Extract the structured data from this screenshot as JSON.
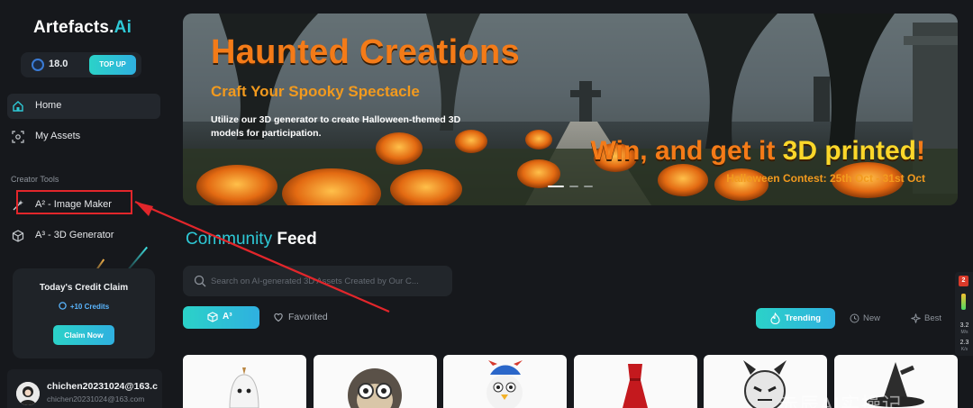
{
  "brand": {
    "name_main": "Artefacts.",
    "name_accent": "Ai"
  },
  "credits": {
    "balance": "18.0",
    "topup_label": "TOP UP"
  },
  "nav": {
    "home": "Home",
    "assets": "My Assets",
    "section": "Creator Tools",
    "image_maker": "A² - Image Maker",
    "generator_3d": "A³ - 3D Generator"
  },
  "claim": {
    "title": "Today's Credit Claim",
    "credits": "+10 Credits",
    "button": "Claim Now"
  },
  "user": {
    "name": "chichen20231024@163.c",
    "email": "chichen20231024@163.com"
  },
  "banner": {
    "title": "Haunted Creations",
    "subtitle": "Craft Your Spooky Spectacle",
    "description": "Utilize our 3D generator to create Halloween-themed 3D models for participation.",
    "win_prefix": "Win, and get it ",
    "win_highlight": "3D printed",
    "win_suffix": "!",
    "date": "Halloween Contest: 25th Oct - 31st Oct"
  },
  "feed": {
    "title_left": "Community",
    "title_right": "Feed",
    "search_placeholder": "Search on AI-generated 3D Assets Created by Our C...",
    "tab_a3": "A³",
    "tab_favorited": "Favorited",
    "sort_trending": "Trending",
    "sort_new": "New",
    "sort_best": "Best"
  },
  "side_widget": {
    "badge": "2",
    "up_val": "3.2",
    "up_unit": "M/s",
    "down_val": "2.3",
    "down_unit": "K/s"
  },
  "watermark": "赤辰AI实操记",
  "colors": {
    "accent": "#2ec9d6",
    "orange": "#f47b18",
    "annotation": "#e2262b"
  }
}
